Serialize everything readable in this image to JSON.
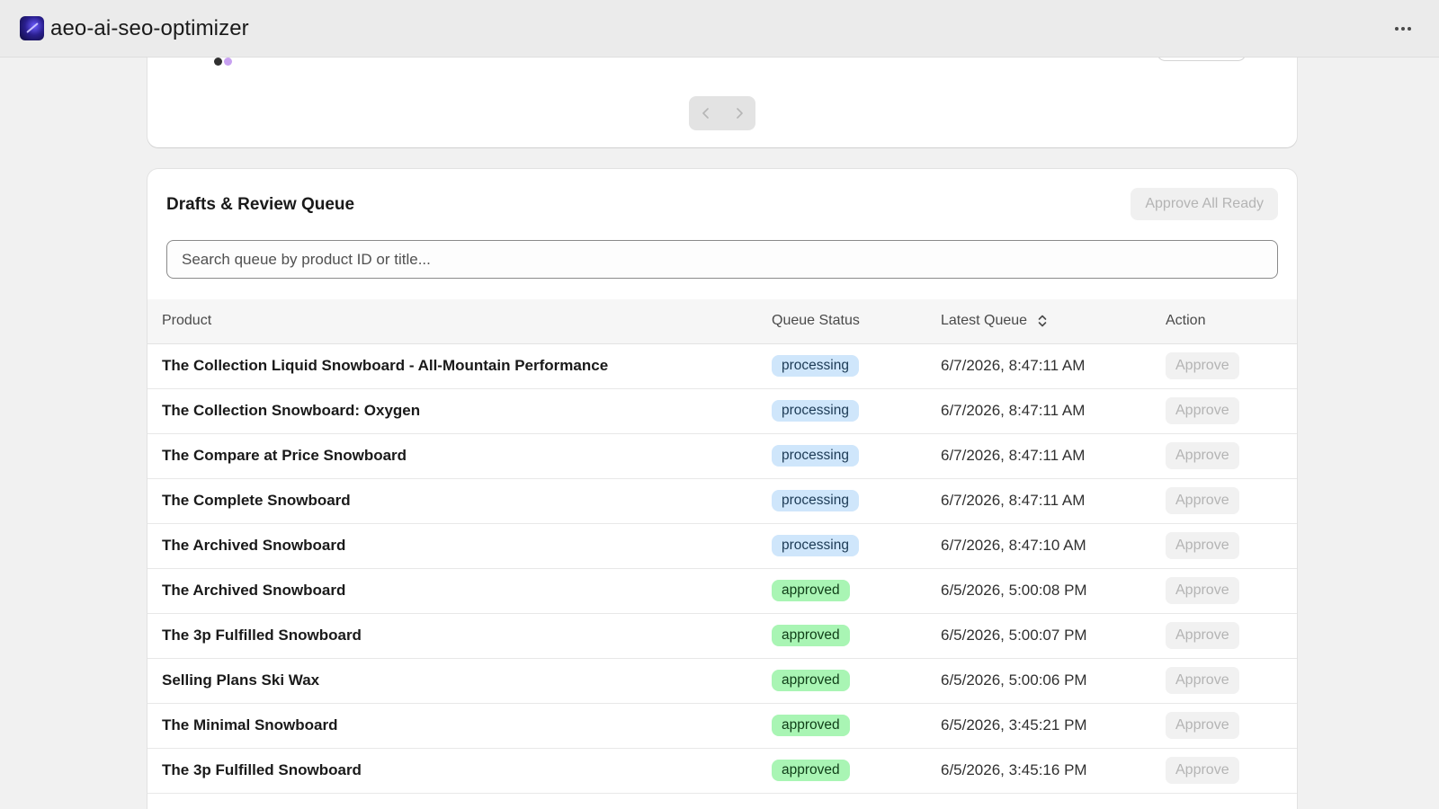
{
  "app": {
    "title": "aeo-ai-seo-optimizer",
    "logo_icon": "app-logo-icon",
    "more_icon": "more-horizontal-icon"
  },
  "pagination": {
    "prev_icon": "chevron-left-icon",
    "next_icon": "chevron-right-icon"
  },
  "queue": {
    "title": "Drafts & Review Queue",
    "approve_all_label": "Approve All Ready",
    "search_placeholder": "Search queue by product ID or title...",
    "search_value": "",
    "columns": {
      "product": "Product",
      "status": "Queue Status",
      "latest": "Latest Queue",
      "action": "Action"
    },
    "sort_icon": "sort-updown-icon",
    "rows": [
      {
        "product": "The Collection Liquid Snowboard - All-Mountain Performance",
        "status": "processing",
        "date": "6/7/2026, 8:47:11 AM",
        "action": "Approve"
      },
      {
        "product": "The Collection Snowboard: Oxygen",
        "status": "processing",
        "date": "6/7/2026, 8:47:11 AM",
        "action": "Approve"
      },
      {
        "product": "The Compare at Price Snowboard",
        "status": "processing",
        "date": "6/7/2026, 8:47:11 AM",
        "action": "Approve"
      },
      {
        "product": "The Complete Snowboard",
        "status": "processing",
        "date": "6/7/2026, 8:47:11 AM",
        "action": "Approve"
      },
      {
        "product": "The Archived Snowboard",
        "status": "processing",
        "date": "6/7/2026, 8:47:10 AM",
        "action": "Approve"
      },
      {
        "product": "The Archived Snowboard",
        "status": "approved",
        "date": "6/5/2026, 5:00:08 PM",
        "action": "Approve"
      },
      {
        "product": "The 3p Fulfilled Snowboard",
        "status": "approved",
        "date": "6/5/2026, 5:00:07 PM",
        "action": "Approve"
      },
      {
        "product": "Selling Plans Ski Wax",
        "status": "approved",
        "date": "6/5/2026, 5:00:06 PM",
        "action": "Approve"
      },
      {
        "product": "The Minimal Snowboard",
        "status": "approved",
        "date": "6/5/2026, 3:45:21 PM",
        "action": "Approve"
      },
      {
        "product": "The 3p Fulfilled Snowboard",
        "status": "approved",
        "date": "6/5/2026, 3:45:16 PM",
        "action": "Approve"
      }
    ]
  },
  "colors": {
    "processing_badge": "#cfe6fb",
    "approved_badge": "#a9f5b4",
    "disabled_text": "#b4b4b4"
  }
}
